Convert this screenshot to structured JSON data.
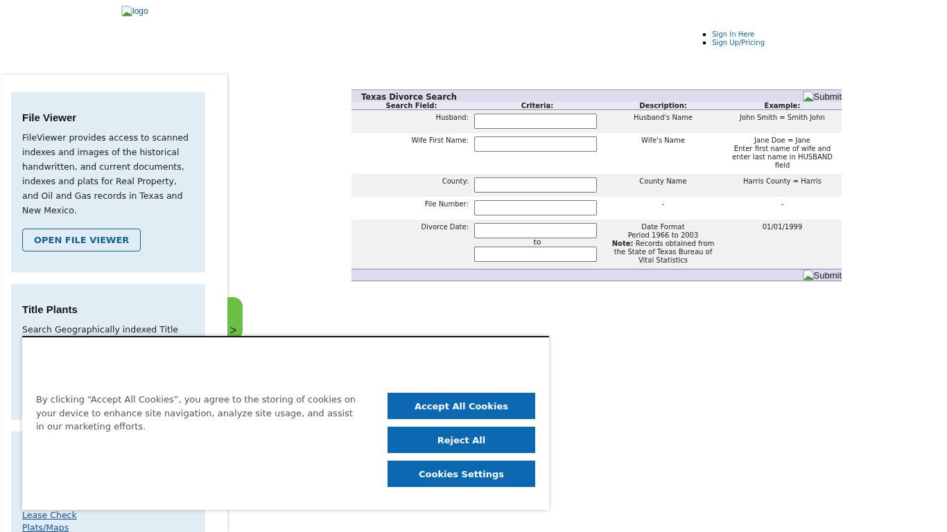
{
  "header": {
    "logo_alt": "logo",
    "nav": [
      {
        "label": "Sign In Here"
      },
      {
        "label": "Sign Up/Pricing"
      }
    ]
  },
  "sidebar": {
    "cards": [
      {
        "title": "File Viewer",
        "text": "FileViewer provides access to scanned indexes and images of the historical handwritten, and current documents, indexes and plats for Real Property, and Oil and Gas records in Texas and New Mexico.",
        "button": "OPEN FILE VIEWER"
      },
      {
        "title": "Title Plants",
        "text": "Search Geographically indexed Title"
      },
      {
        "links": [
          "Lease Check",
          "Plats/Maps"
        ]
      }
    ],
    "toggle": ">"
  },
  "search": {
    "title": "Texas Divorce Search",
    "submit": "Submit",
    "columns": [
      "Search Field:",
      "Criteria:",
      "Description:",
      "Example:"
    ],
    "rows": [
      {
        "field": "Husband:",
        "kind": "single",
        "description": [
          "Husband's Name"
        ],
        "example": [
          "John Smith = Smith John"
        ]
      },
      {
        "field": "Wife First Name:",
        "kind": "single",
        "description": [
          "Wife's Name"
        ],
        "example": [
          "Jane Doe = Jane",
          "Enter first name of wife and",
          "enter last name in HUSBAND",
          "field"
        ]
      },
      {
        "field": "County:",
        "kind": "single",
        "description": [
          "County Name"
        ],
        "example": [
          "Harris County = Harris"
        ]
      },
      {
        "field": "File Number:",
        "kind": "single",
        "description": [
          "-"
        ],
        "example": [
          "-"
        ]
      },
      {
        "field": "Divorce Date:",
        "kind": "range",
        "separator": "to",
        "description": [
          "Date Format",
          "Period 1966 to 2003",
          "**Note:** Records obtained from",
          "the State of Texas Bureau of",
          "Vital Statistics"
        ],
        "example": [
          "01/01/1999"
        ]
      }
    ],
    "footer_submit": "Submit"
  },
  "cookie_banner": {
    "text": "By clicking “Accept All Cookies”, you agree to the storing of cookies on your device to enhance site navigation, analyze site usage, and assist in our marketing efforts.",
    "buttons": [
      "Accept All Cookies",
      "Reject All",
      "Cookies Settings"
    ]
  }
}
